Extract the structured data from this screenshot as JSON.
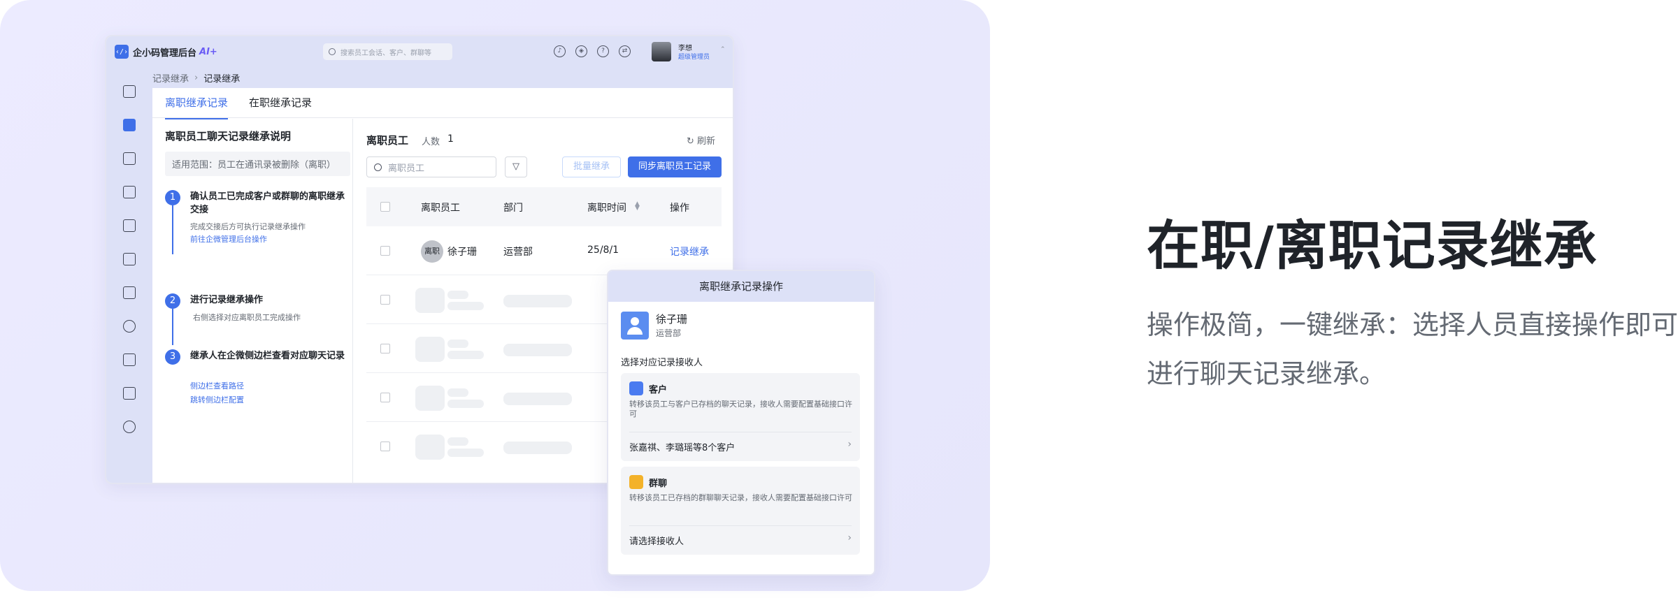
{
  "app": {
    "name": "企小码管理后台",
    "ai_badge": "AI+",
    "search_placeholder": "搜索员工会话、客户、群聊等",
    "user": {
      "name": "李想",
      "role": "超级管理员"
    }
  },
  "breadcrumb": {
    "parent": "记录继承",
    "current": "记录继承"
  },
  "tabs": [
    {
      "label": "离职继承记录",
      "active": true
    },
    {
      "label": "在职继承记录",
      "active": false
    }
  ],
  "guide": {
    "title": "离职员工聊天记录继承说明",
    "scope": "适用范围：员工在通讯录被删除（离职）",
    "steps": [
      {
        "num": "1",
        "title": "确认员工已完成客户或群聊的离职继承交接",
        "desc": "完成交接后方可执行记录继承操作",
        "links": [
          "前往企微管理后台操作"
        ]
      },
      {
        "num": "2",
        "title": "进行记录继承操作",
        "desc": "右侧选择对应离职员工完成操作",
        "links": []
      },
      {
        "num": "3",
        "title": "继承人在企微侧边栏查看对应聊天记录",
        "desc": "",
        "links": [
          "侧边栏查看路径",
          "跳转侧边栏配置"
        ]
      }
    ]
  },
  "list": {
    "title": "离职员工",
    "count_label": "人数",
    "count": "1",
    "refresh": "刷新",
    "search_placeholder": "离职员工",
    "batch_button": "批量继承",
    "sync_button": "同步离职员工记录",
    "columns": [
      "离职员工",
      "部门",
      "离职时间",
      "操作"
    ],
    "rows": [
      {
        "badge": "离职",
        "name": "徐子珊",
        "dept": "运营部",
        "date": "25/8/1",
        "action": "记录继承"
      }
    ]
  },
  "panel": {
    "title": "离职继承记录操作",
    "employee": {
      "name": "徐子珊",
      "dept": "运营部"
    },
    "subtitle": "选择对应记录接收人",
    "cards": [
      {
        "title": "客户",
        "desc": "转移该员工与客户已存档的聊天记录，接收人需要配置基础接口许可",
        "action": "张嘉祺、李璐瑶等8个客户",
        "color": "#4a7bf0"
      },
      {
        "title": "群聊",
        "desc": "转移该员工已存档的群聊聊天记录，接收人需要配置基础接口许可",
        "action": "请选择接收人",
        "color": "#f3b22a"
      }
    ]
  },
  "headline": "在职/离职记录继承",
  "tagline": "操作极简，一键继承：选择人员直接操作即可进行聊天记录继承。",
  "colors": {
    "accent": "#3f6fe8",
    "hero_bg": "#e8e8fc",
    "sidebar": "#dde1f7"
  }
}
